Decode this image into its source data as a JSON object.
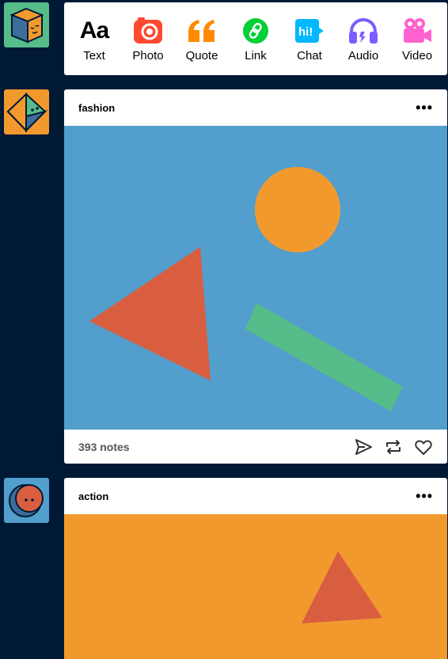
{
  "composer": {
    "items": [
      {
        "label": "Text",
        "icon": "text-icon",
        "color": "#000000"
      },
      {
        "label": "Photo",
        "icon": "camera-icon",
        "color": "#ff4930"
      },
      {
        "label": "Quote",
        "icon": "quote-icon",
        "color": "#ff8a00"
      },
      {
        "label": "Link",
        "icon": "link-icon",
        "color": "#00cf35"
      },
      {
        "label": "Chat",
        "icon": "chat-icon",
        "color": "#00b8ff"
      },
      {
        "label": "Audio",
        "icon": "headphones-icon",
        "color": "#7c5cff"
      },
      {
        "label": "Video",
        "icon": "video-camera-icon",
        "color": "#ff62ce"
      }
    ]
  },
  "posts": [
    {
      "blog": "fashion",
      "notes": "393 notes"
    },
    {
      "blog": "action"
    }
  ],
  "colors": {
    "background": "#001935",
    "photo_bg_1": "#529ecc",
    "photo_bg_2": "#f2992e",
    "orange": "#f2992e",
    "red": "#d95e40",
    "green": "#56bc8a"
  }
}
